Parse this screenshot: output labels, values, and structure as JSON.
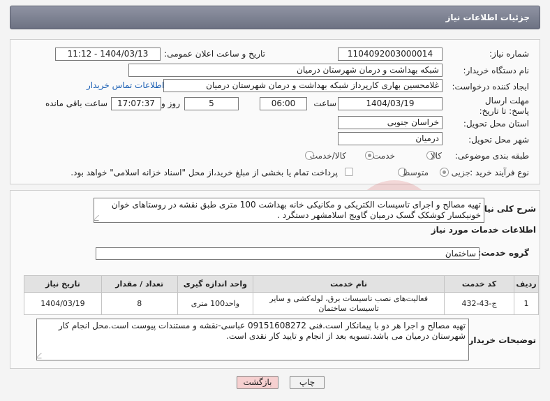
{
  "header": {
    "title": "جزئیات اطلاعات نیاز"
  },
  "labels": {
    "need_number": "شماره نیاز:",
    "announce_datetime": "تاریخ و ساعت اعلان عمومی:",
    "buyer_org": "نام دستگاه خریدار:",
    "requester": "ایجاد کننده درخواست:",
    "deadline": "مهلت ارسال پاسخ: تا تاریخ:",
    "time_word": "ساعت",
    "days_and": "روز و",
    "remaining": "ساعت باقی مانده",
    "province": "استان محل تحویل:",
    "city": "شهر محل تحویل:",
    "category": "طبقه بندی موضوعی:",
    "purchase_type": "نوع فرآیند خرید :",
    "description": "شرح کلی نیاز:",
    "services_info": "اطلاعات خدمات مورد نیاز",
    "service_group": "گروه خدمت:",
    "buyer_notes": "توضیحات خریدار:"
  },
  "values": {
    "need_number": "1104092003000014",
    "announce_datetime": "1404/03/13 - 11:12",
    "buyer_org": "شبکه بهداشت و درمان شهرستان درمیان",
    "requester": "غلامحسین بهاری کارپرداز شبکه بهداشت و درمان شهرستان درمیان",
    "contact_link": "اطلاعات تماس خریدار",
    "deadline_date": "1404/03/19",
    "deadline_time": "06:00",
    "days": "5",
    "remaining_time": "17:07:37",
    "province": "خراسان جنوبی",
    "city": "درمیان",
    "service_group": "ساختمان"
  },
  "category_options": [
    {
      "label": "کالا",
      "selected": false
    },
    {
      "label": "خدمت",
      "selected": true
    },
    {
      "label": "کالا/خدمت",
      "selected": false
    }
  ],
  "purchase_options": [
    {
      "label": "جزیی",
      "selected": true
    },
    {
      "label": "متوسط",
      "selected": false
    }
  ],
  "treasury_note": "پرداخت تمام یا بخشی از مبلغ خرید،از محل \"اسناد خزانه اسلامی\" خواهد بود.",
  "description_text": "تهیه مصالح و اجرای تاسیسات الکتریکی و مکانیکی خانه بهداشت 100 متری طبق نقشه در روستاهای خوان خونیکسار کوشکک گسک درمیان گاویج اسلامشهر دستگرد .",
  "table": {
    "headers": [
      "ردیف",
      "کد خدمت",
      "نام خدمت",
      "واحد اندازه گیری",
      "تعداد / مقدار",
      "تاریخ نیاز"
    ],
    "rows": [
      [
        "1",
        "ج-43-432",
        "فعالیت‌های نصب تاسیسات برق، لوله‌کشی و سایر تاسیسات ساختمان",
        "واحد100 متری",
        "8",
        "1404/03/19"
      ]
    ]
  },
  "buyer_notes_text": "تهیه مصالح و اجرا هر دو با پیمانکار است.فنی 09151608272 عباسی-نقشه و مستندات پیوست است.محل انجام کار شهرستان درمیان می باشد.تسویه بعد از انجام و تایید کار نقدی است.",
  "buttons": {
    "print": "چاپ",
    "back": "بازگشت"
  },
  "colors": {
    "header": "#7d8192",
    "link": "#1a5fb4",
    "back_button": "#f6d0d0"
  }
}
